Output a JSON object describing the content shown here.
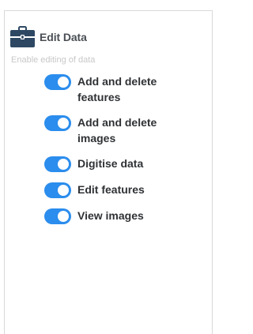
{
  "panel": {
    "title": "Edit Data",
    "subtitle": "Enable editing of data",
    "icon": "briefcase-icon",
    "accent_color": "#2b8ded",
    "icon_color": "#2e4863"
  },
  "toggles": [
    {
      "label": "Add and delete features",
      "enabled": true
    },
    {
      "label": "Add and delete images",
      "enabled": true
    },
    {
      "label": "Digitise data",
      "enabled": true
    },
    {
      "label": "Edit features",
      "enabled": true
    },
    {
      "label": "View images",
      "enabled": true
    }
  ]
}
